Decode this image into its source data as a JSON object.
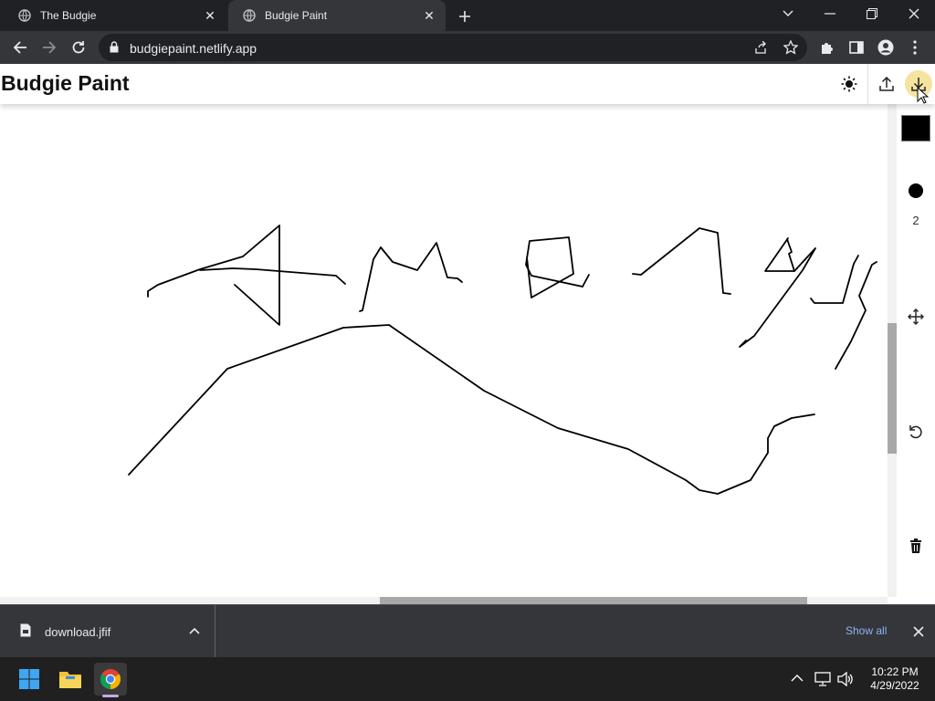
{
  "browser": {
    "tabs": [
      {
        "title": "The Budgie",
        "favicon": "globe-icon",
        "active": false
      },
      {
        "title": "Budgie Paint",
        "favicon": "globe-icon",
        "active": true
      }
    ],
    "url": "budgiepaint.netlify.app"
  },
  "app": {
    "title": "Budgie Paint",
    "header_icons": [
      "brightness-icon",
      "upload-icon",
      "download-icon"
    ],
    "sidebar": {
      "color": "#000000",
      "brush_size": "2",
      "icons": [
        "color-swatch",
        "brush-size-dot",
        "move-icon",
        "undo-icon",
        "trash-icon"
      ]
    }
  },
  "download_bar": {
    "file_name": "download.jfif",
    "show_all": "Show all"
  },
  "taskbar": {
    "time": "10:22 PM",
    "date": "4/29/2022"
  },
  "colors": {
    "accent_download": "#f5e3a0",
    "link": "#8ab4f8"
  }
}
